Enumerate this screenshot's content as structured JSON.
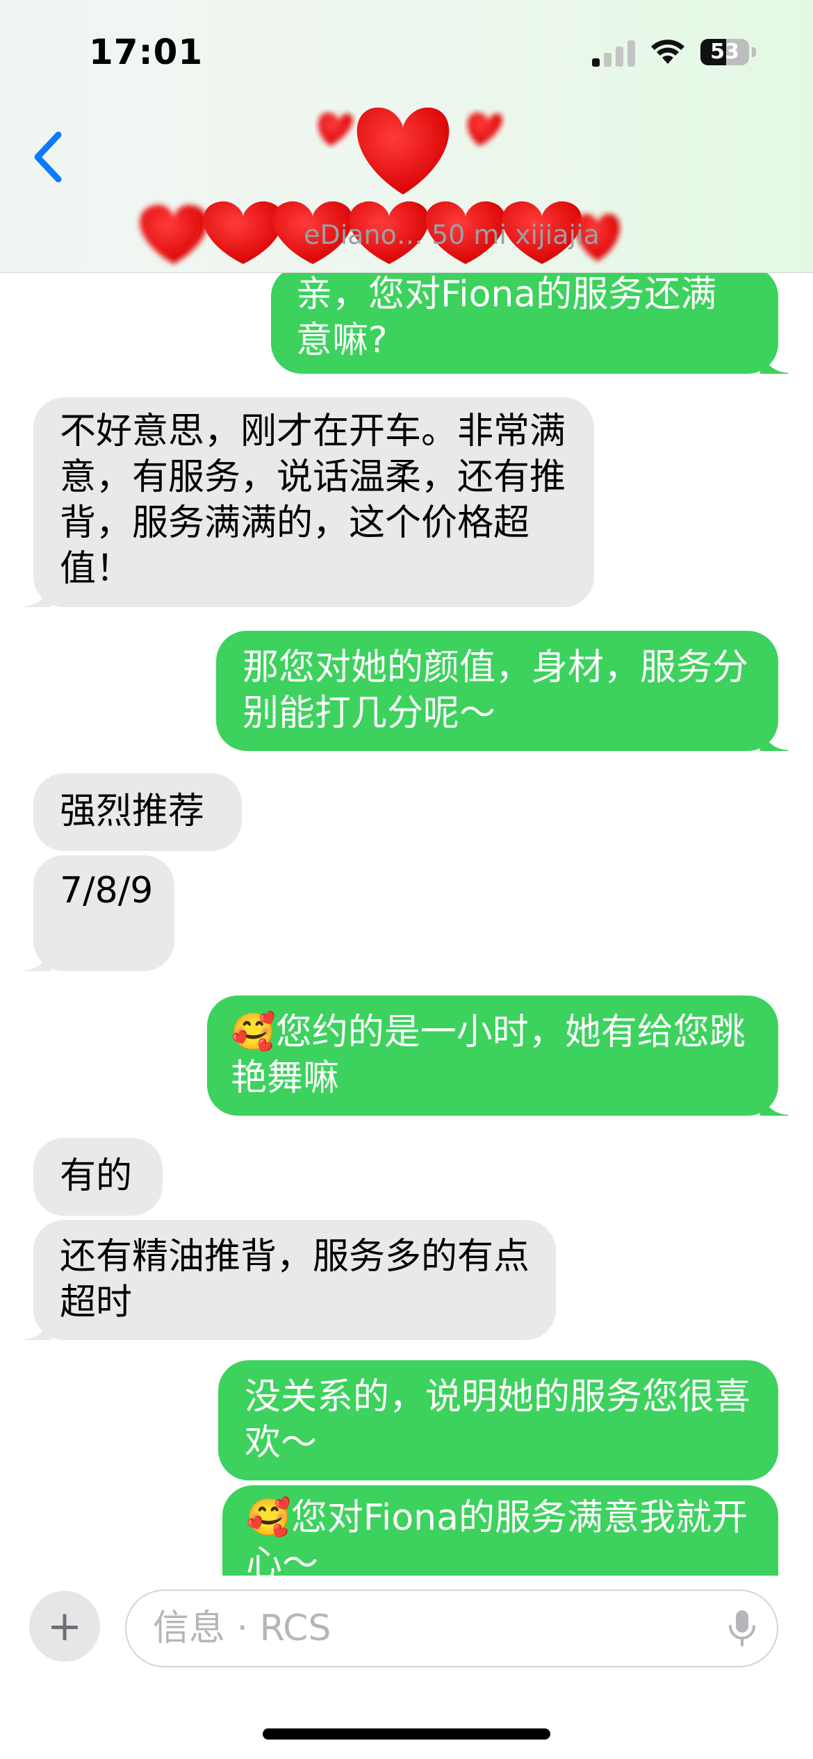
{
  "status_bar": {
    "time": "17:01",
    "battery": "53",
    "battery_level": 0.53
  },
  "header": {
    "back_icon": "chevron-left-icon",
    "avatar": "hearts-sticker",
    "contact_name_partial": "eDiano…  50 mi xijiajia"
  },
  "messages": [
    {
      "id": "m1",
      "direction": "outgoing",
      "text": "亲，您对Fiona的服务还满意嘛?"
    },
    {
      "id": "m2",
      "direction": "incoming",
      "text": "不好意思，刚才在开车。非常满意，有服务，说话温柔，还有推背，服务满满的，这个价格超值！"
    },
    {
      "id": "m3",
      "direction": "outgoing",
      "text": "那您对她的颜值，身材，服务分别能打几分呢～"
    },
    {
      "id": "m4",
      "direction": "incoming",
      "text": "强烈推荐"
    },
    {
      "id": "m5",
      "direction": "incoming",
      "text": "7/8/9"
    },
    {
      "id": "m6",
      "direction": "outgoing",
      "text": "🥰您约的是一小时，她有给您跳艳舞嘛"
    },
    {
      "id": "m7",
      "direction": "incoming",
      "text": "有的"
    },
    {
      "id": "m8",
      "direction": "incoming",
      "text": "还有精油推背，服务多的有点超时"
    },
    {
      "id": "m9",
      "direction": "outgoing",
      "text": "没关系的，说明她的服务您很喜欢～"
    },
    {
      "id": "m10",
      "direction": "outgoing",
      "text": "🥰您对Fiona的服务满意我就开心～"
    }
  ],
  "composer": {
    "plus_label": "+",
    "placeholder": "信息 · RCS",
    "mic_icon": "microphone-icon"
  },
  "colors": {
    "outgoing": "#3cd25d",
    "incoming": "#e9e9eb",
    "accent": "#0a7aff"
  }
}
